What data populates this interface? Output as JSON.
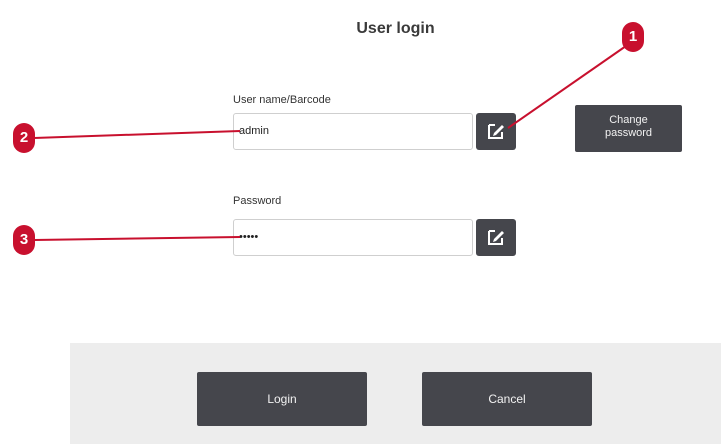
{
  "dialog": {
    "title": "User login",
    "username": {
      "label": "User name/Barcode",
      "value": "admin"
    },
    "password": {
      "label": "Password",
      "value": "•••••"
    },
    "change_password_label_line1": "Change",
    "change_password_label_line2": "password",
    "login_label": "Login",
    "cancel_label": "Cancel"
  },
  "callouts": {
    "one": "1",
    "two": "2",
    "three": "3"
  },
  "colors": {
    "button": "#45464c",
    "callout": "#c8102e",
    "footer": "#ededed"
  },
  "icons": {
    "edit": "edit-pencil-icon"
  }
}
